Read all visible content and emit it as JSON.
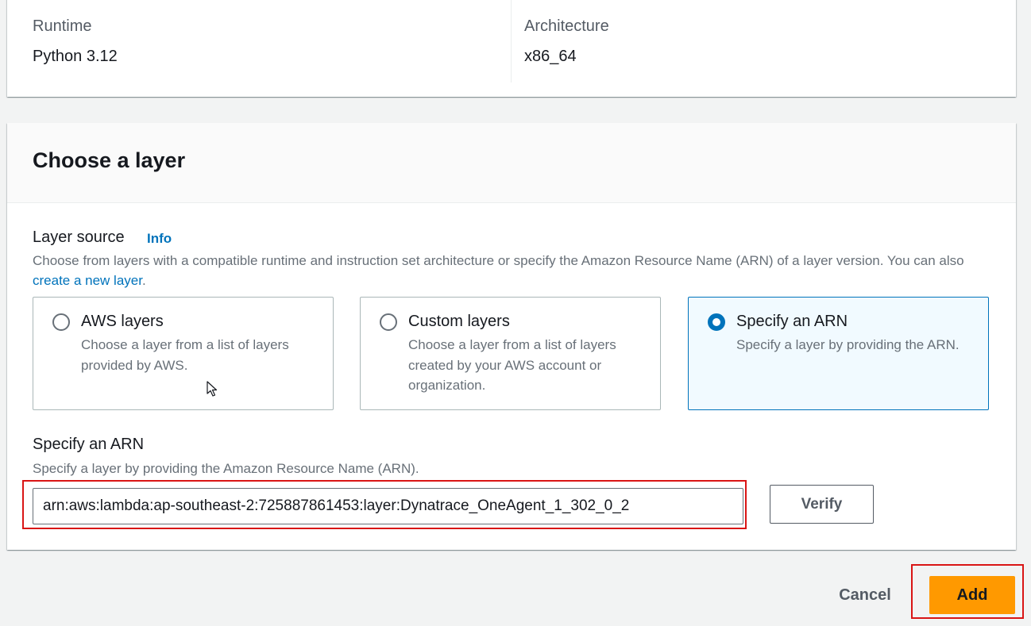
{
  "function_info": {
    "runtime_label": "Runtime",
    "runtime_value": "Python 3.12",
    "architecture_label": "Architecture",
    "architecture_value": "x86_64"
  },
  "choose_layer": {
    "title": "Choose a layer",
    "layer_source_label": "Layer source",
    "info_link": "Info",
    "description_text": "Choose from layers with a compatible runtime and instruction set architecture or specify the Amazon Resource Name (ARN) of a layer version. You can also ",
    "create_link": "create a new layer",
    "description_end": ".",
    "options": [
      {
        "title": "AWS layers",
        "description": "Choose a layer from a list of layers provided by AWS.",
        "selected": false
      },
      {
        "title": "Custom layers",
        "description": "Choose a layer from a list of layers created by your AWS account or organization.",
        "selected": false
      },
      {
        "title": "Specify an ARN",
        "description": "Specify a layer by providing the ARN.",
        "selected": true
      }
    ],
    "arn_label": "Specify an ARN",
    "arn_description": "Specify a layer by providing the Amazon Resource Name (ARN).",
    "arn_value": "arn:aws:lambda:ap-southeast-2:725887861453:layer:Dynatrace_OneAgent_1_302_0_2",
    "verify_button": "Verify"
  },
  "footer": {
    "cancel_button": "Cancel",
    "add_button": "Add"
  },
  "colors": {
    "accent": "#0073bb",
    "primary_button": "#ff9900",
    "highlight": "#d91515"
  }
}
